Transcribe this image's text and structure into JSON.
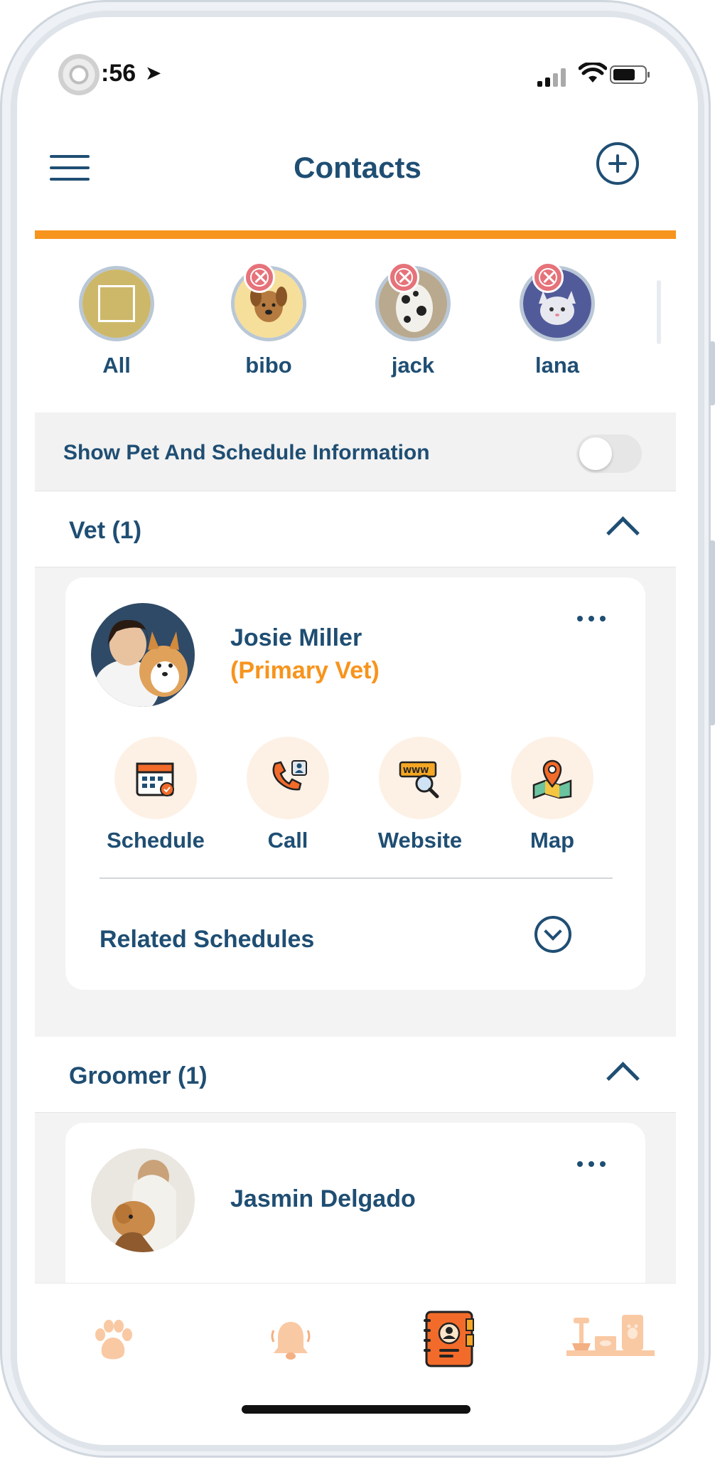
{
  "status_bar": {
    "time": ":56"
  },
  "header": {
    "title": "Contacts"
  },
  "pets": [
    {
      "name": "All"
    },
    {
      "name": "bibo"
    },
    {
      "name": "jack"
    },
    {
      "name": "lana"
    }
  ],
  "info_toggle": {
    "label": "Show Pet And Schedule Information",
    "on": false
  },
  "sections": [
    {
      "label": "Vet (1)",
      "contact": {
        "name": "Josie Miller",
        "role": "(Primary Vet)",
        "actions": [
          {
            "label": "Schedule",
            "icon": "calendar-icon"
          },
          {
            "label": "Call",
            "icon": "phone-icon"
          },
          {
            "label": "Website",
            "icon": "website-icon"
          },
          {
            "label": "Map",
            "icon": "map-icon"
          }
        ],
        "related_label": "Related Schedules"
      }
    },
    {
      "label": "Groomer (1)",
      "contact": {
        "name": "Jasmin Delgado"
      }
    }
  ],
  "tabbar": {
    "items": [
      {
        "icon": "paw-icon",
        "active": false
      },
      {
        "icon": "bell-icon",
        "active": false
      },
      {
        "icon": "contacts-book-icon",
        "active": true
      },
      {
        "icon": "pet-supplies-icon",
        "active": false
      }
    ]
  },
  "colors": {
    "primary": "#1f4e73",
    "accent": "#f7941d",
    "section_bg": "#f3f3f3"
  }
}
